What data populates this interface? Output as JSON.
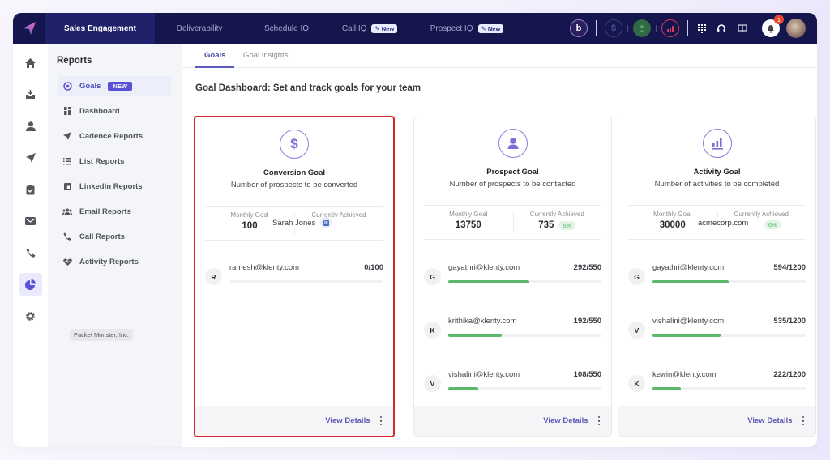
{
  "topbar": {
    "logo": "klenty-logo-icon",
    "tabs": [
      {
        "label": "Sales Engagement",
        "active": true,
        "new": false
      },
      {
        "label": "Deliverability",
        "active": false,
        "new": false
      },
      {
        "label": "Schedule IQ",
        "active": false,
        "new": false
      },
      {
        "label": "Call IQ",
        "active": false,
        "new": true
      },
      {
        "label": "Prospect IQ",
        "active": false,
        "new": true
      }
    ],
    "new_pill_label": "✎ New",
    "icons": [
      "playbook-icon",
      "dollar-icon",
      "user-icon",
      "chart-icon",
      "dialpad-icon",
      "headset-icon",
      "book-icon",
      "bell-icon",
      "avatar"
    ],
    "notification_count": "1"
  },
  "rail": {
    "items": [
      "home-icon",
      "inbox-icon",
      "prospects-icon",
      "cadence-icon",
      "tasks-icon",
      "email-icon",
      "calls-icon",
      "reports-icon",
      "settings-icon"
    ],
    "active": "reports-icon"
  },
  "sidebar": {
    "title": "Reports",
    "items": [
      {
        "label": "Goals",
        "icon": "target-icon",
        "active": true,
        "badge": "NEW"
      },
      {
        "label": "Dashboard",
        "icon": "dashboard-icon"
      },
      {
        "label": "Cadence Reports",
        "icon": "send-icon"
      },
      {
        "label": "List Reports",
        "icon": "list-icon"
      },
      {
        "label": "LinkedIn Reports",
        "icon": "linkedin-icon"
      },
      {
        "label": "Email Reports",
        "icon": "group-icon"
      },
      {
        "label": "Call Reports",
        "icon": "phone-icon"
      },
      {
        "label": "Activity Reports",
        "icon": "heartbeat-icon"
      }
    ],
    "org_chip": "Packet Monster, Inc."
  },
  "main": {
    "tabs": [
      {
        "label": "Goals",
        "active": true
      },
      {
        "label": "Goal Insights",
        "active": false
      }
    ],
    "heading": "Goal Dashboard: Set and track goals for your team",
    "monthly_goal_label": "Monthly Goal",
    "achieved_label": "Currently Achieved",
    "view_details_label": "View Details",
    "cards": [
      {
        "title": "Conversion Goal",
        "description": "Number of prospects to be converted",
        "icon": "dollar-icon",
        "selected": true,
        "monthly_goal": "100",
        "achieved": "",
        "achieved_pct": "",
        "overlay": {
          "text": "Sarah Jones",
          "icon": "linkedin-icon"
        },
        "members": [
          {
            "initial": "R",
            "email": "ramesh@klenty.com",
            "count": "0/100",
            "progress": 0.0
          }
        ]
      },
      {
        "title": "Prospect Goal",
        "description": "Number of prospects to be contacted",
        "icon": "user-icon",
        "selected": false,
        "monthly_goal": "13750",
        "achieved": "735",
        "achieved_pct": "5%",
        "members": [
          {
            "initial": "G",
            "email": "gayathri@klenty.com",
            "count": "292/550",
            "progress": 0.531
          },
          {
            "initial": "K",
            "email": "krithika@klenty.com",
            "count": "192/550",
            "progress": 0.349
          },
          {
            "initial": "V",
            "email": "vishalini@klenty.com",
            "count": "108/550",
            "progress": 0.196
          }
        ]
      },
      {
        "title": "Activity Goal",
        "description": "Number of activities to be completed",
        "icon": "bar-chart-icon",
        "selected": false,
        "monthly_goal": "30000",
        "achieved": "",
        "achieved_pct": "6%",
        "overlay": {
          "text": "acmecorp.com"
        },
        "members": [
          {
            "initial": "G",
            "email": "gayathri@klenty.com",
            "count": "594/1200",
            "progress": 0.495
          },
          {
            "initial": "V",
            "email": "vishalini@klenty.com",
            "count": "535/1200",
            "progress": 0.446
          },
          {
            "initial": "K",
            "email": "kewin@klenty.com",
            "count": "222/1200",
            "progress": 0.185
          }
        ]
      }
    ]
  },
  "colors": {
    "nav_bg": "#14164d",
    "accent": "#5a52d5",
    "progress": "#5cb86b",
    "selected_border": "#d9262c"
  }
}
